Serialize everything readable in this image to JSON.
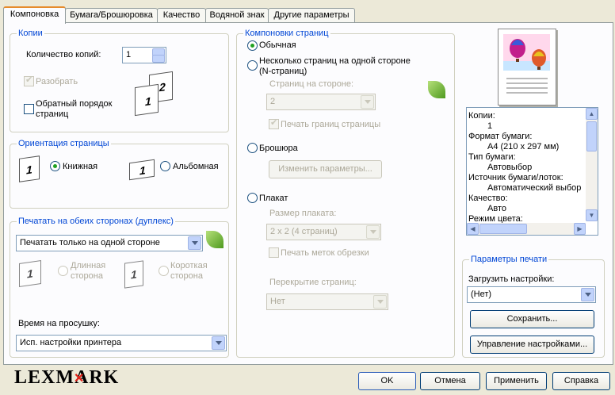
{
  "tabs": [
    "Компоновка",
    "Бумага/Брошюровка",
    "Качество",
    "Водяной знак",
    "Другие параметры"
  ],
  "copies": {
    "title": "Копии",
    "count_label": "Количество копий:",
    "count_value": "1",
    "collate_label": "Разобрать",
    "reverse_label_1": "Обратный порядок",
    "reverse_label_2": "страниц"
  },
  "orientation": {
    "title": "Ориентация страницы",
    "portrait": "Книжная",
    "landscape": "Альбомная"
  },
  "duplex": {
    "title": "Печатать на обеих сторонах (дуплекс)",
    "selected": "Печатать только на одной стороне",
    "long_edge_1": "Длинная",
    "long_edge_2": "сторона",
    "short_edge_1": "Короткая",
    "short_edge_2": "сторона",
    "drying_label": "Время на просушку:",
    "drying_selected": "Исп. настройки принтера"
  },
  "layouts": {
    "title": "Компоновки страниц",
    "normal": "Обычная",
    "nup_1": "Несколько страниц на одной стороне",
    "nup_2": "(N-страниц)",
    "pages_per_side_label": "Страниц на стороне:",
    "pages_per_side_value": "2",
    "print_borders": "Печать границ страницы",
    "booklet": "Брошюра",
    "booklet_button": "Изменить параметры...",
    "poster": "Плакат",
    "poster_size_label": "Размер плаката:",
    "poster_size_value": "2 x 2 (4 страниц)",
    "crop_marks": "Печать меток обрезки",
    "overlap_label": "Перекрытие страниц:",
    "overlap_value": "Нет"
  },
  "summary": [
    {
      "text": "Копии:",
      "indent": false
    },
    {
      "text": "1",
      "indent": true
    },
    {
      "text": "Формат бумаги:",
      "indent": false
    },
    {
      "text": "A4 (210 x 297 мм)",
      "indent": true
    },
    {
      "text": "Тип бумаги:",
      "indent": false
    },
    {
      "text": "Автовыбор",
      "indent": true
    },
    {
      "text": "Источник бумаги/лоток:",
      "indent": false
    },
    {
      "text": "Автоматический выбор",
      "indent": true
    },
    {
      "text": "Качество:",
      "indent": false
    },
    {
      "text": "Авто",
      "indent": true
    },
    {
      "text": "Режим цвета:",
      "indent": false
    }
  ],
  "print_settings": {
    "title": "Параметры печати",
    "load_label": "Загрузить настройки:",
    "load_value": "(Нет)",
    "save_button": "Сохранить...",
    "manage_button": "Управление настройками..."
  },
  "footer": {
    "logo": "LEXMARK",
    "ok": "OK",
    "cancel": "Отмена",
    "apply": "Применить",
    "help": "Справка"
  },
  "colors": {
    "group_title": "#0046d5",
    "logo_accent": "#e2231a",
    "radio_dot": "#21a121"
  }
}
